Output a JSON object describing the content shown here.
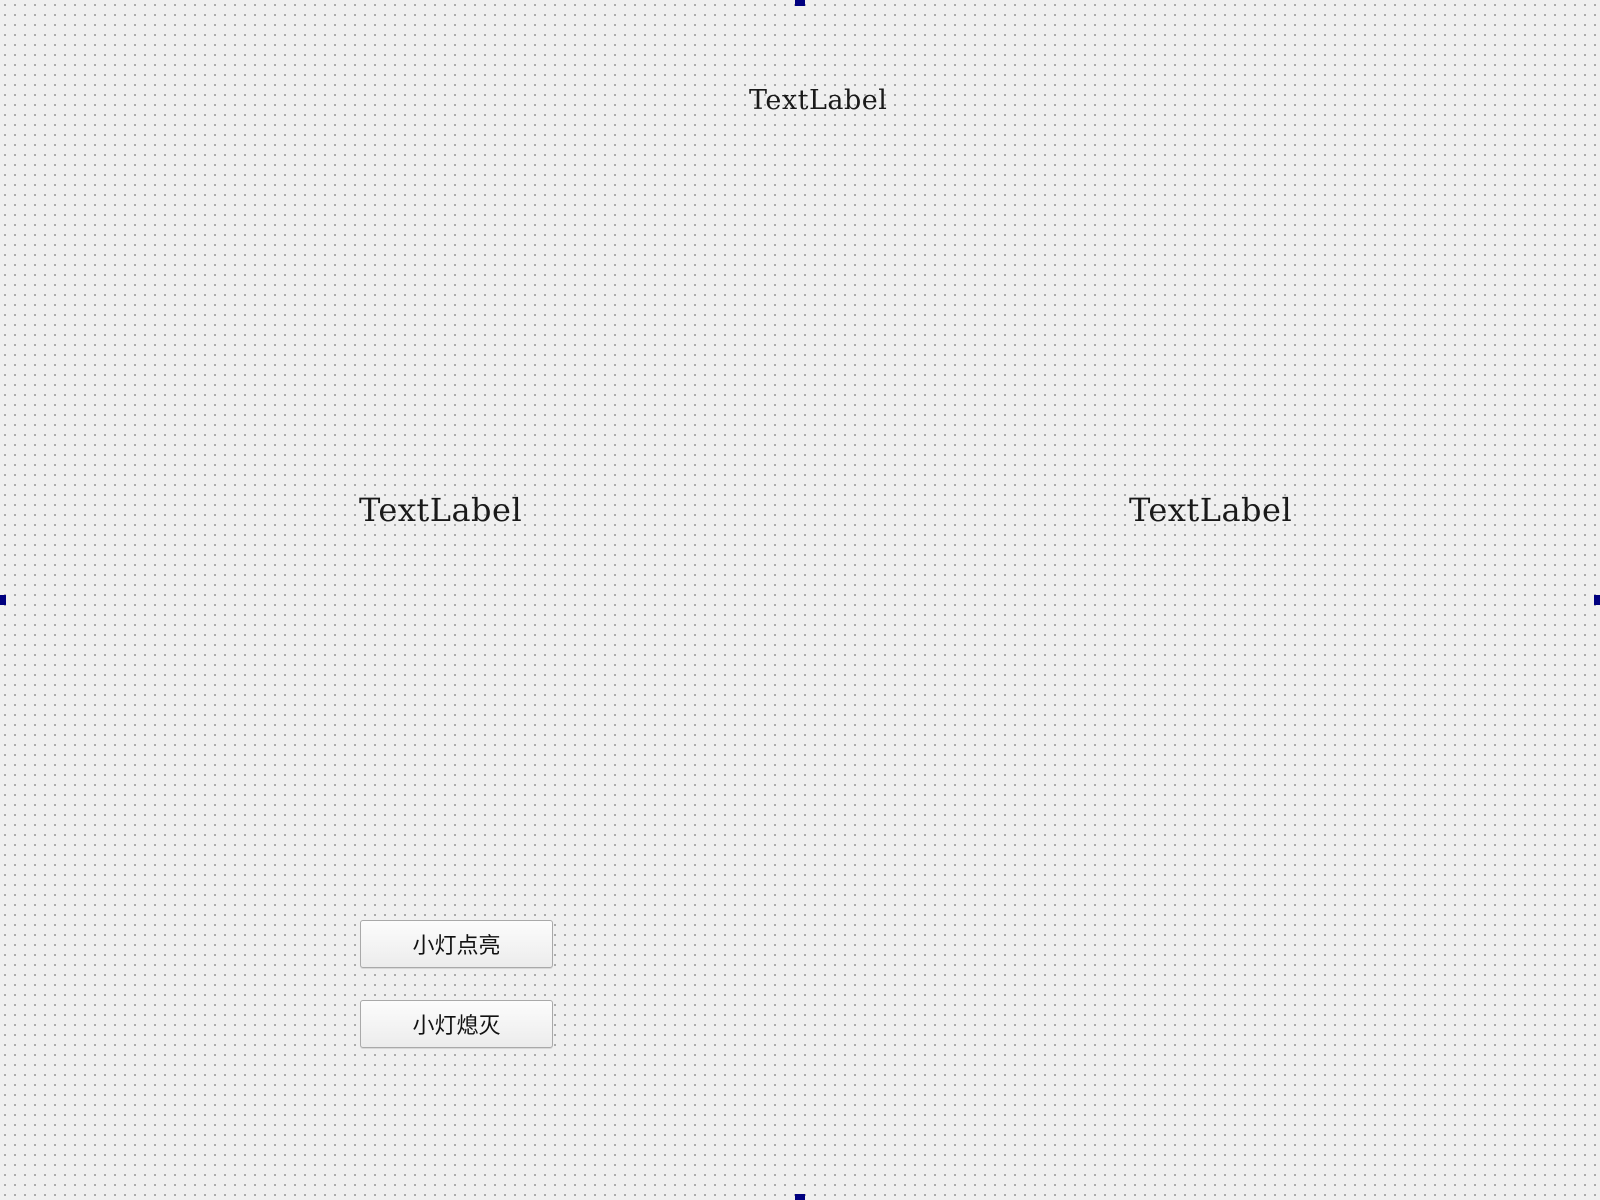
{
  "form": {
    "labels": {
      "top": "TextLabel",
      "left": "TextLabel",
      "right": "TextLabel"
    },
    "buttons": {
      "light_on": "小灯点亮",
      "light_off": "小灯熄灭"
    }
  },
  "colors": {
    "background": "#f0f0f0",
    "grid_dot": "#9a9a9a",
    "selection_handle": "#000080",
    "button_border": "#a9a9a9"
  }
}
